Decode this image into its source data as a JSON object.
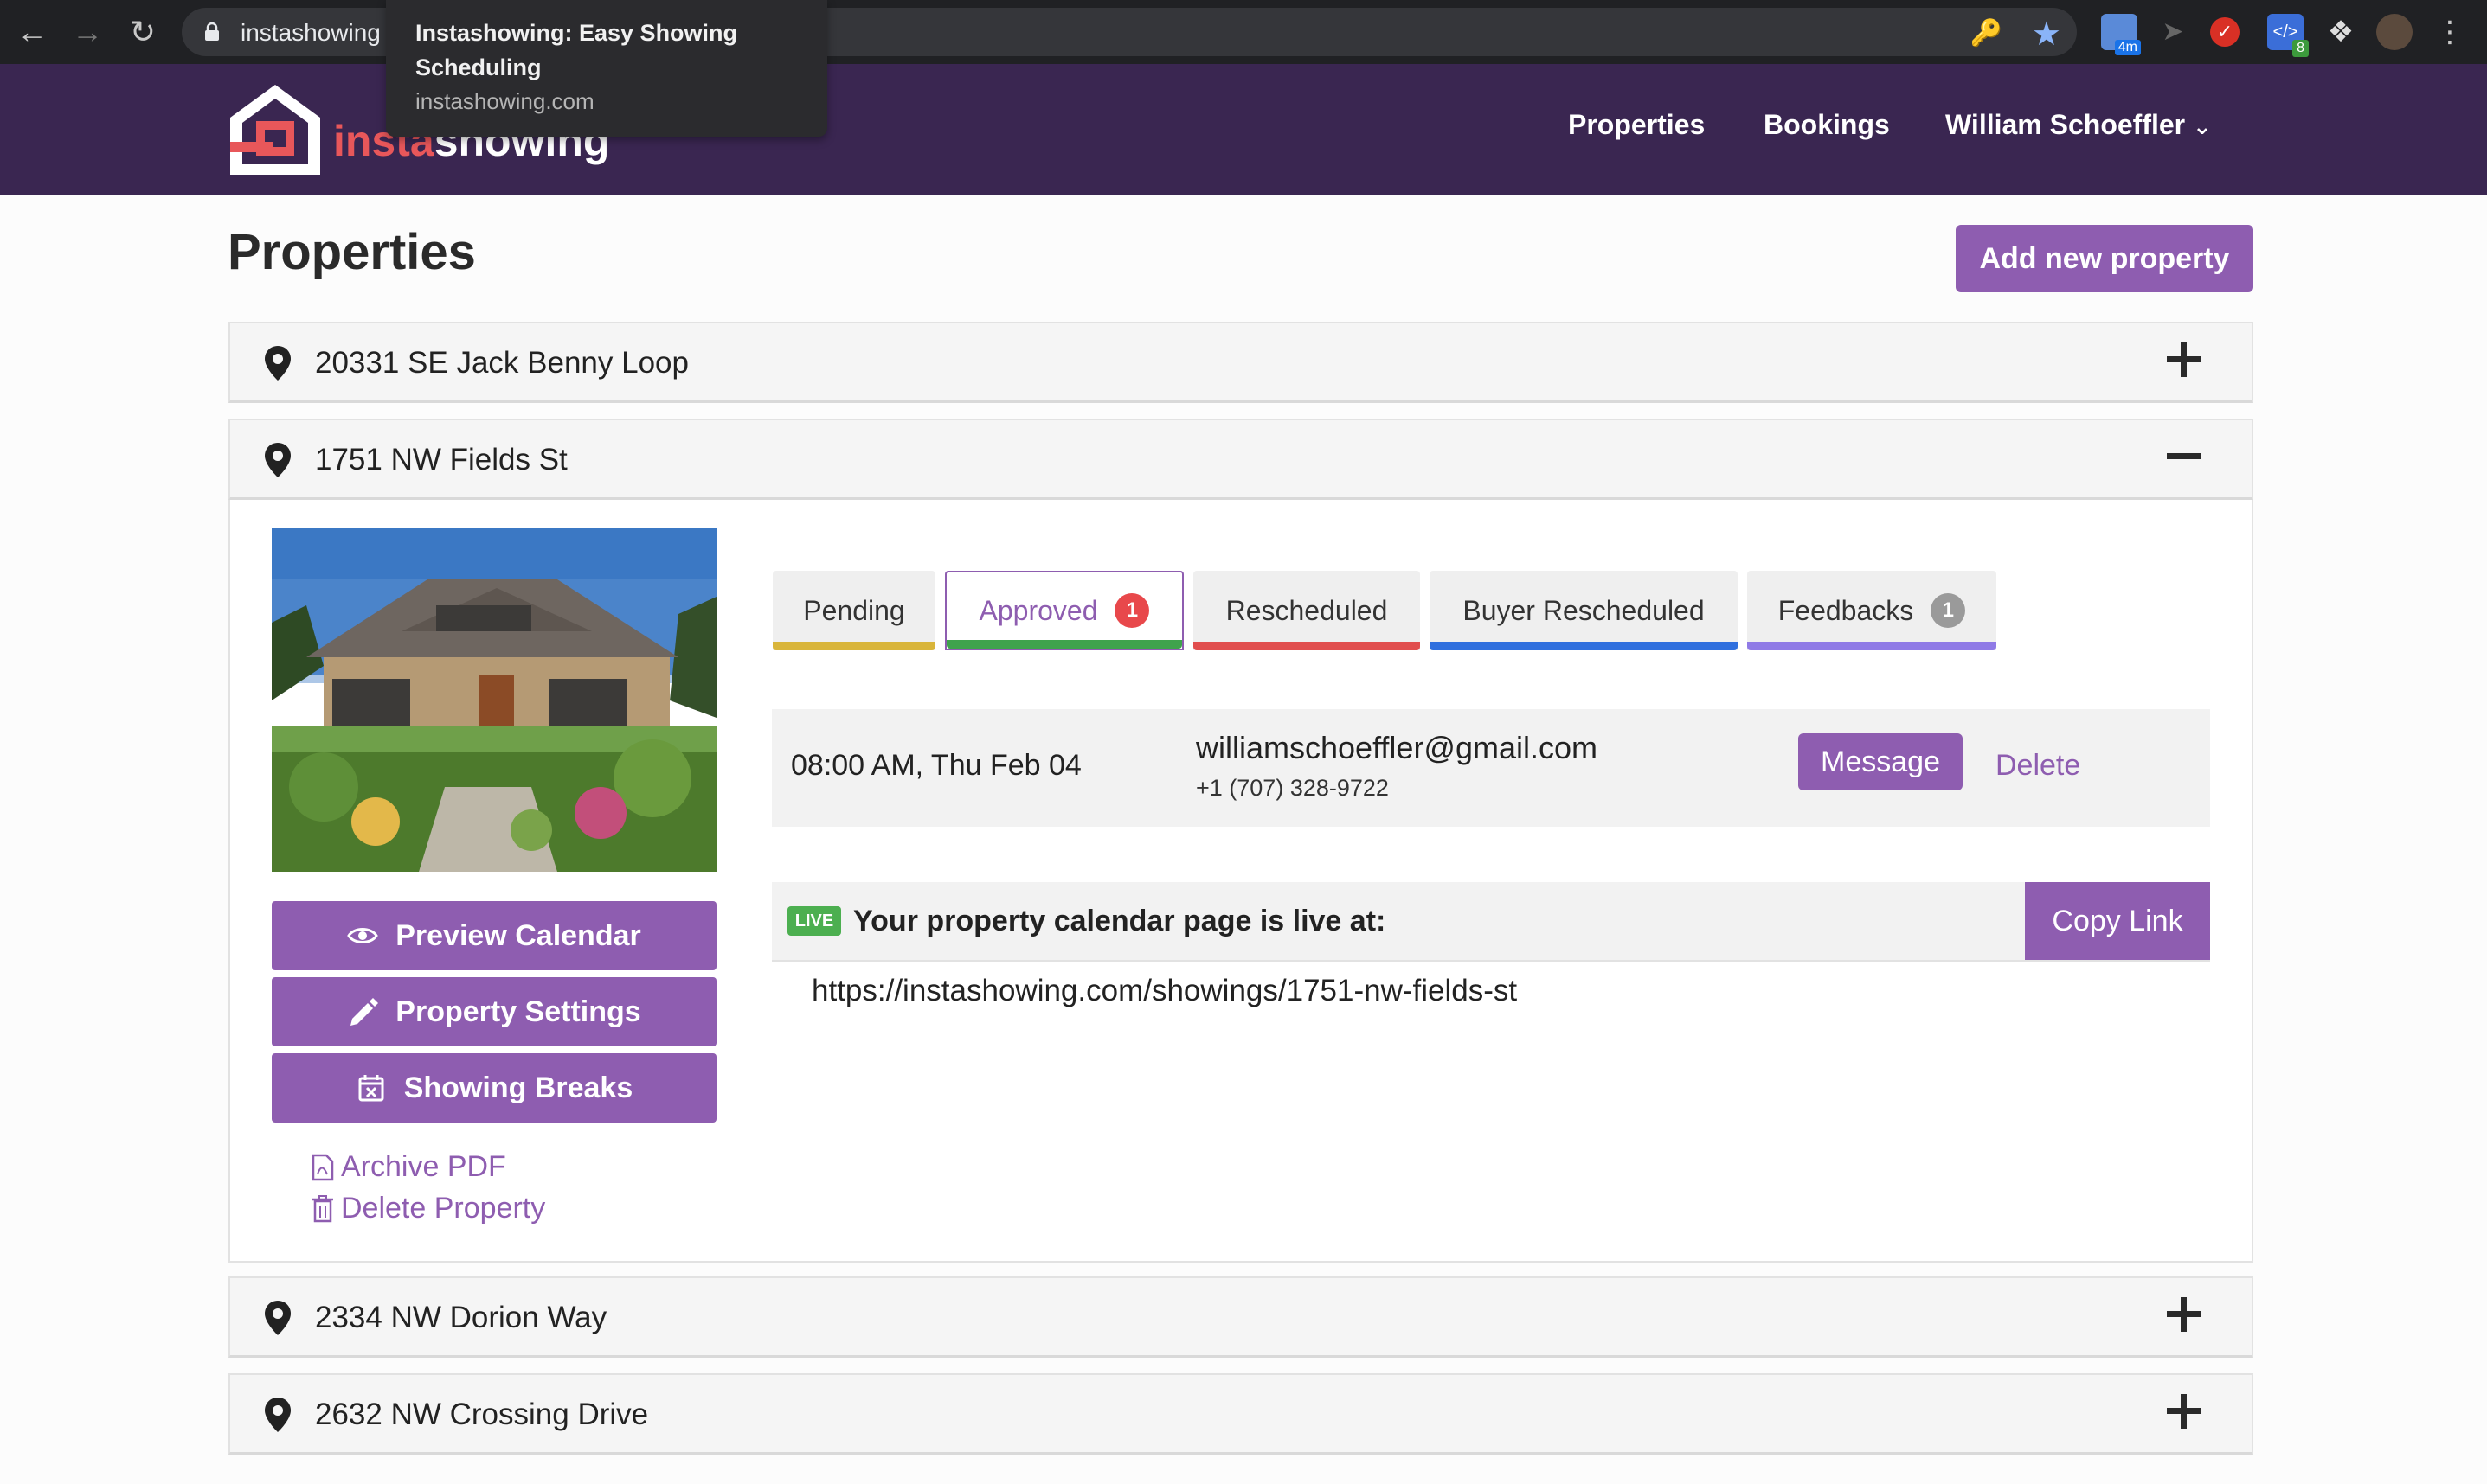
{
  "browser": {
    "url_text": "instashowing",
    "tooltip_title": "Instashowing: Easy Showing Scheduling",
    "tooltip_domain": "instashowing.com",
    "ext_badge_1": "4m",
    "ext_badge_2": "8"
  },
  "header": {
    "logo_text_a": "insta",
    "logo_text_b": "showing",
    "nav": {
      "properties": "Properties",
      "bookings": "Bookings",
      "user": "William Schoeffler"
    }
  },
  "page": {
    "title": "Properties",
    "add_button": "Add new property"
  },
  "properties": [
    {
      "address": "20331 SE Jack Benny Loop",
      "expanded": false
    },
    {
      "address": "1751 NW Fields St",
      "expanded": true
    },
    {
      "address": "2334 NW Dorion Way",
      "expanded": false
    },
    {
      "address": "2632 NW Crossing Drive",
      "expanded": false
    }
  ],
  "detail": {
    "buttons": {
      "preview_calendar": "Preview Calendar",
      "property_settings": "Property Settings",
      "showing_breaks": "Showing Breaks"
    },
    "links": {
      "archive_pdf": "Archive PDF",
      "delete_property": "Delete Property"
    },
    "tabs": [
      {
        "label": "Pending",
        "color": "#d9b53a"
      },
      {
        "label": "Approved",
        "count": "1",
        "color": "#3fa34d",
        "badge_color": "#e8484b"
      },
      {
        "label": "Rescheduled",
        "color": "#e14e4e"
      },
      {
        "label": "Buyer Rescheduled",
        "color": "#2f6fde"
      },
      {
        "label": "Feedbacks",
        "count": "1",
        "color": "#8f7ae6",
        "badge_color": "#9a9a9a"
      }
    ],
    "booking": {
      "time": "08:00 AM, Thu Feb 04",
      "email": "williamschoeffler@gmail.com",
      "phone": "+1 (707) 328-9722",
      "message_button": "Message",
      "delete_link": "Delete"
    },
    "live": {
      "badge": "LIVE",
      "text": "Your property calendar page is live at:",
      "copy_button": "Copy Link",
      "url": "https://instashowing.com/showings/1751-nw-fields-st"
    }
  },
  "colors": {
    "brand_purple": "#8e5db0",
    "header_bg": "#3a2651",
    "logo_red": "#e8575a"
  }
}
